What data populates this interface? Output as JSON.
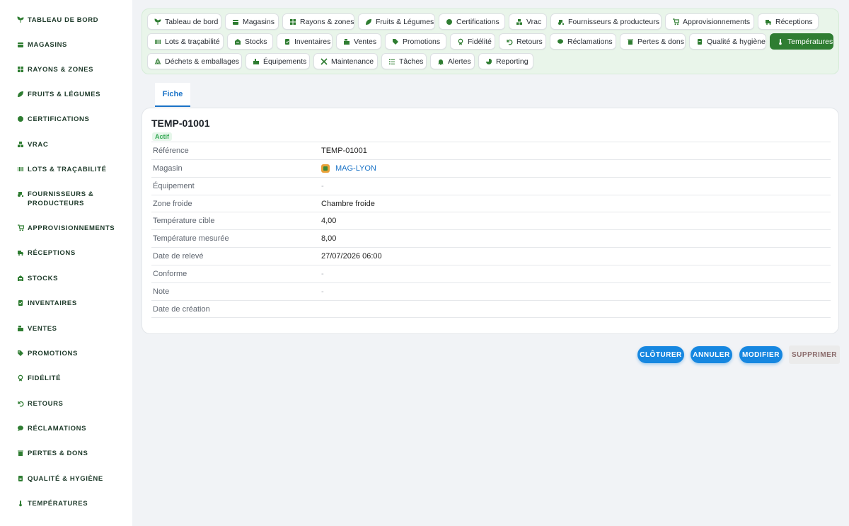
{
  "sidebar": {
    "items": [
      {
        "label": "TABLEAU DE BORD",
        "icon": "sprout-icon"
      },
      {
        "label": "MAGASINS",
        "icon": "store-icon"
      },
      {
        "label": "RAYONS & ZONES",
        "icon": "grid-icon"
      },
      {
        "label": "FRUITS & LÉGUMES",
        "icon": "leaf-icon"
      },
      {
        "label": "CERTIFICATIONS",
        "icon": "certificate-icon"
      },
      {
        "label": "VRAC",
        "icon": "boxes-icon"
      },
      {
        "label": "LOTS & TRAÇABILITÉ",
        "icon": "barcode-icon"
      },
      {
        "label": "FOURNISSEURS & PRODUCTEURS",
        "icon": "tractor-icon"
      },
      {
        "label": "APPROVISIONNEMENTS",
        "icon": "cart-icon"
      },
      {
        "label": "RÉCEPTIONS",
        "icon": "truck-icon"
      },
      {
        "label": "STOCKS",
        "icon": "warehouse-icon"
      },
      {
        "label": "INVENTAIRES",
        "icon": "clipboard-check-icon"
      },
      {
        "label": "VENTES",
        "icon": "cash-register-icon"
      },
      {
        "label": "PROMOTIONS",
        "icon": "tags-icon"
      },
      {
        "label": "FIDÉLITÉ",
        "icon": "award-icon"
      },
      {
        "label": "RETOURS",
        "icon": "undo-icon"
      },
      {
        "label": "RÉCLAMATIONS",
        "icon": "comment-icon"
      },
      {
        "label": "PERTES & DONS",
        "icon": "trash-icon"
      },
      {
        "label": "QUALITÉ & HYGIÈNE",
        "icon": "clipboard-icon"
      },
      {
        "label": "TEMPÉRATURES",
        "icon": "thermometer-icon"
      }
    ]
  },
  "nav": {
    "chips": [
      {
        "label": "Tableau de bord",
        "icon": "sprout-icon"
      },
      {
        "label": "Magasins",
        "icon": "store-icon"
      },
      {
        "label": "Rayons & zones",
        "icon": "grid-icon"
      },
      {
        "label": "Fruits & Légumes",
        "icon": "leaf-icon"
      },
      {
        "label": "Certifications",
        "icon": "certificate-icon"
      },
      {
        "label": "Vrac",
        "icon": "boxes-icon"
      },
      {
        "label": "Fournisseurs & producteurs",
        "icon": "tractor-icon"
      },
      {
        "label": "Approvisionnements",
        "icon": "cart-icon"
      },
      {
        "label": "Réceptions",
        "icon": "truck-icon"
      },
      {
        "label": "Lots & traçabilité",
        "icon": "barcode-icon"
      },
      {
        "label": "Stocks",
        "icon": "warehouse-icon"
      },
      {
        "label": "Inventaires",
        "icon": "clipboard-check-icon"
      },
      {
        "label": "Ventes",
        "icon": "cash-register-icon"
      },
      {
        "label": "Promotions",
        "icon": "tags-icon"
      },
      {
        "label": "Fidélité",
        "icon": "award-icon"
      },
      {
        "label": "Retours",
        "icon": "undo-icon"
      },
      {
        "label": "Réclamations",
        "icon": "comment-icon"
      },
      {
        "label": "Pertes & dons",
        "icon": "trash-icon"
      },
      {
        "label": "Qualité & hygiène",
        "icon": "clipboard-icon"
      },
      {
        "label": "Températures",
        "icon": "thermometer-icon",
        "active": true
      },
      {
        "label": "Déchets & emballages",
        "icon": "recycle-icon"
      },
      {
        "label": "Équipements",
        "icon": "equipment-icon"
      },
      {
        "label": "Maintenance",
        "icon": "tools-icon"
      },
      {
        "label": "Tâches",
        "icon": "list-icon"
      },
      {
        "label": "Alertes",
        "icon": "bell-icon"
      },
      {
        "label": "Reporting",
        "icon": "pie-chart-icon"
      }
    ]
  },
  "tabs": [
    {
      "label": "Fiche"
    }
  ],
  "record": {
    "title": "TEMP-01001",
    "status": "Actif",
    "fields": [
      {
        "label": "Référence",
        "value": "TEMP-01001"
      },
      {
        "label": "Magasin",
        "value": "MAG-LYON"
      },
      {
        "label": "Équipement",
        "value": "-"
      },
      {
        "label": "Zone froide",
        "value": "Chambre froide"
      },
      {
        "label": "Température cible",
        "value": "4,00"
      },
      {
        "label": "Température mesurée",
        "value": "8,00"
      },
      {
        "label": "Date de relevé",
        "value": "27/07/2026 06:00"
      },
      {
        "label": "Conforme",
        "value": "-"
      },
      {
        "label": "Note",
        "value": "-"
      },
      {
        "label": "Date de création",
        "value": ""
      }
    ]
  },
  "actions": {
    "close_label": "CLÔTURER",
    "cancel_label": "ANNULER",
    "edit_label": "MODIFIER",
    "delete_label": "SUPPRIMER"
  },
  "colors": {
    "accent_green": "#2f7d32",
    "accent_blue": "#1687e0",
    "panel_green": "#e9f5ea"
  }
}
